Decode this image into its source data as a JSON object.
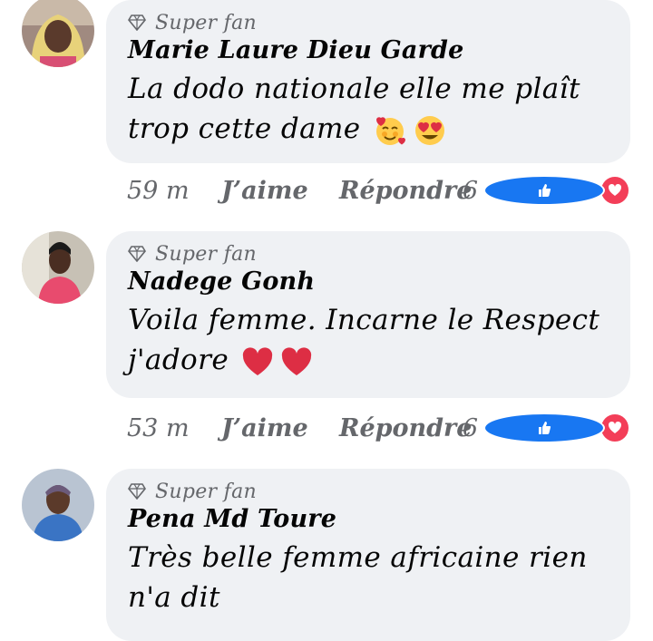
{
  "comments": [
    {
      "badge": "Super fan",
      "name": "Marie Laure Dieu Garde",
      "text_line1": "La dodo nationale elle me plaît",
      "text_line2": "trop cette dame",
      "emojis": [
        "smiling-face-with-hearts",
        "heart-eyes"
      ],
      "time": "59 m",
      "like_label": "J’aime",
      "reply_label": "Répondre",
      "reaction_count": "6"
    },
    {
      "badge": "Super fan",
      "name": "Nadege Gonh",
      "text_line1": "Voila femme.  Incarne le Respect",
      "text_line2": "j'adore",
      "emojis": [
        "red-heart",
        "red-heart"
      ],
      "time": "53 m",
      "like_label": "J’aime",
      "reply_label": "Répondre",
      "reaction_count": "6"
    },
    {
      "badge": "Super fan",
      "name": "Pena Md Toure",
      "text_line1": "Très belle femme africaine rien",
      "text_line2": "n'a dit"
    }
  ],
  "colors": {
    "bubble": "#eff1f4",
    "secondary_text": "#65676b",
    "like_blue": "#1877f2",
    "love_red": "#f33e58"
  }
}
